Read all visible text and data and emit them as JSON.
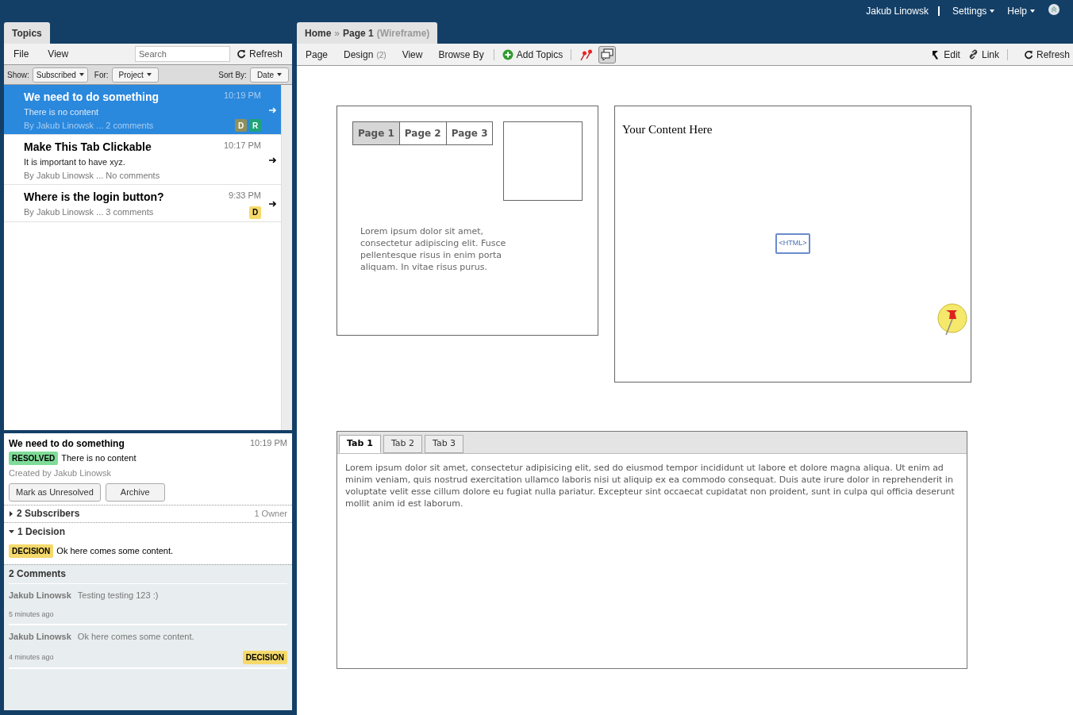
{
  "header": {
    "user": "Jakub Linowsk",
    "menus": [
      "Settings",
      "Help"
    ]
  },
  "topics_panel": {
    "tab": "Topics",
    "menu": [
      "File",
      "View"
    ],
    "search": {
      "placeholder": "Search"
    },
    "refresh": "Refresh",
    "filters": {
      "show_label": "Show:",
      "show": "Subscribed",
      "for_label": "For:",
      "for": "Project",
      "sort_label": "Sort By:",
      "sort": "Date"
    },
    "topics": [
      {
        "title": "We need to do something",
        "time": "10:19 PM",
        "content": "There is no content",
        "meta": "By Jakub Linowsk ... 2 comments",
        "selected": true,
        "badges": [
          {
            "label": "D",
            "color": "#8f8f5a"
          },
          {
            "label": "R",
            "color": "#1fa37a"
          }
        ]
      },
      {
        "title": "Make This Tab Clickable",
        "time": "10:17 PM",
        "content": "It is important to have xyz.",
        "meta": "By Jakub Linowsk ... No comments",
        "selected": false
      },
      {
        "title": "Where is the login button?",
        "time": "9:33 PM",
        "meta": "By Jakub Linowsk ... 3 comments",
        "selected": false,
        "badges": [
          {
            "label": "D",
            "color": "#f5d96b"
          }
        ]
      }
    ]
  },
  "detail": {
    "title": "We need to do something",
    "time": "10:19 PM",
    "status": "RESOLVED",
    "content": "There is no content",
    "created": "Created by Jakub Linowsk",
    "buttons": [
      "Mark as Unresolved",
      "Archive"
    ],
    "subscribers": {
      "label": "2 Subscribers",
      "owner": "1 Owner",
      "expanded": false
    },
    "decisions": {
      "label": "1 Decision",
      "expanded": true,
      "items": [
        {
          "tag": "DECISION",
          "text": "Ok here comes some content."
        }
      ]
    },
    "comments_title": "2 Comments",
    "comments": [
      {
        "author": "Jakub Linowsk",
        "text": "Testing testing 123 :)",
        "ago": "5 minutes ago"
      },
      {
        "author": "Jakub Linowsk",
        "text": "Ok here comes some content.",
        "ago": "4 minutes ago",
        "tag": "DECISION"
      }
    ]
  },
  "page_panel": {
    "breadcrumb": {
      "home": "Home",
      "separator": "»",
      "page": "Page 1",
      "suffix": "(Wireframe)"
    },
    "menu": [
      {
        "label": "Page"
      },
      {
        "label": "Design",
        "count": "(2)"
      },
      {
        "label": "View"
      },
      {
        "label": "Browse By"
      }
    ],
    "add_topics": "Add Topics",
    "comments_toggle_on": true,
    "right_actions": [
      "Edit",
      "Link",
      "Refresh"
    ]
  },
  "wireframe": {
    "page_tabs": [
      {
        "label": "Page 1",
        "selected": true
      },
      {
        "label": "Page 2",
        "selected": false
      },
      {
        "label": "Page 3",
        "selected": false
      }
    ],
    "lorem_short": "Lorem ipsum dolor sit amet, consectetur adipiscing elit. Fusce pellentesque risus in enim porta aliquam. In vitae risus purus.",
    "content_heading": "Your Content Here",
    "html_label": "<HTML>",
    "tabs": [
      {
        "label": "Tab 1",
        "selected": true
      },
      {
        "label": "Tab 2",
        "selected": false
      },
      {
        "label": "Tab 3",
        "selected": false
      }
    ],
    "tab_text": "Lorem ipsum dolor sit amet, consectetur adipisicing elit, sed do eiusmod tempor incididunt ut labore et dolore magna aliqua. Ut enim ad minim veniam, quis nostrud exercitation ullamco laboris nisi ut aliquip ex ea commodo consequat. Duis aute irure dolor in reprehenderit in voluptate velit esse cillum dolore eu fugiat nulla pariatur. Excepteur sint occaecat cupidatat non proident, sunt in culpa qui officia deserunt mollit anim id est laborum."
  }
}
